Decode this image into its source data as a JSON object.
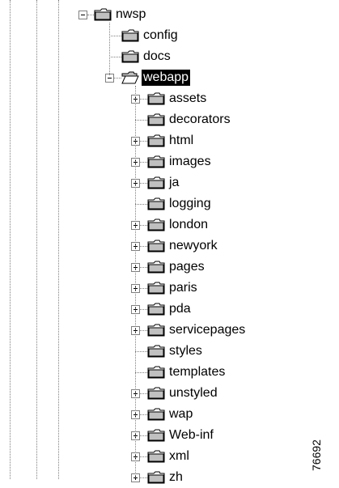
{
  "tree": {
    "root": {
      "label": "nwsp",
      "expanded": true
    },
    "root_children": [
      {
        "label": "config"
      },
      {
        "label": "docs"
      },
      {
        "label": "webapp",
        "expanded": true,
        "selected": true
      }
    ],
    "webapp_children": [
      {
        "label": "assets",
        "expandable": true
      },
      {
        "label": "decorators",
        "expandable": false
      },
      {
        "label": "html",
        "expandable": true
      },
      {
        "label": "images",
        "expandable": true
      },
      {
        "label": "ja",
        "expandable": true
      },
      {
        "label": "logging",
        "expandable": false
      },
      {
        "label": "london",
        "expandable": true
      },
      {
        "label": "newyork",
        "expandable": true
      },
      {
        "label": "pages",
        "expandable": true
      },
      {
        "label": "paris",
        "expandable": true
      },
      {
        "label": "pda",
        "expandable": true
      },
      {
        "label": "servicepages",
        "expandable": true
      },
      {
        "label": "styles",
        "expandable": false
      },
      {
        "label": "templates",
        "expandable": false
      },
      {
        "label": "unstyled",
        "expandable": true
      },
      {
        "label": "wap",
        "expandable": true
      },
      {
        "label": "Web-inf",
        "expandable": true
      },
      {
        "label": "xml",
        "expandable": true
      },
      {
        "label": "zh",
        "expandable": true
      }
    ]
  },
  "figure_id": "76692",
  "icons": {
    "closed_folder": "folder-icon",
    "open_folder": "folder-open-icon"
  }
}
